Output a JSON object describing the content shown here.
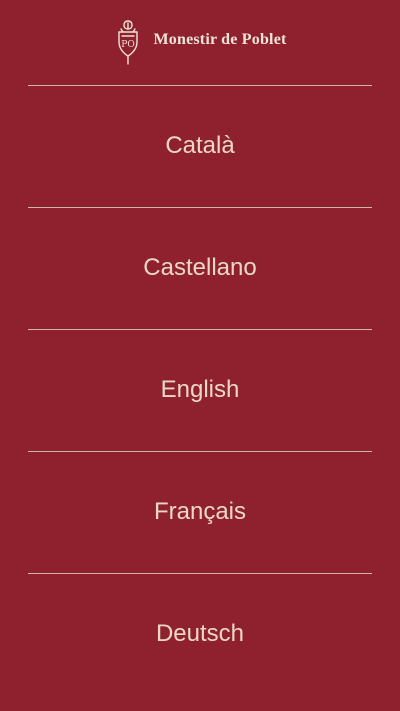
{
  "header": {
    "logo_text": "Monestir de Poblet",
    "logo_icon": "poblet-crest-icon"
  },
  "languages": [
    {
      "label": "Català"
    },
    {
      "label": "Castellano"
    },
    {
      "label": "English"
    },
    {
      "label": "Français"
    },
    {
      "label": "Deutsch"
    }
  ],
  "colors": {
    "background": "#8f212e",
    "text": "#ead8c5",
    "divider": "#d9c4b2"
  }
}
